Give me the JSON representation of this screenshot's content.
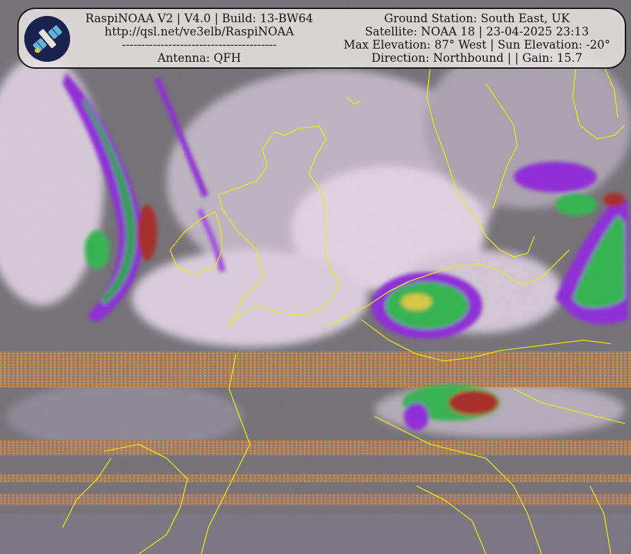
{
  "header": {
    "left": {
      "title": "RaspiNOAA V2 | V4.0 | Build: 13-BW64",
      "url": "http://qsl.net/ve3elb/RaspiNOAA",
      "divider": "----------------------------------------",
      "antenna": "Antenna: QFH"
    },
    "right": {
      "station": "Ground Station: South East, UK",
      "satellite": "Satellite: NOAA 18 | 23-04-2025 23:13",
      "elevation": "Max Elevation: 87° West | Sun Elevation: -20°",
      "direction": "Direction: Northbound | | Gain: 15.7"
    }
  },
  "logo": {
    "icon": "satellite-icon"
  },
  "colors": {
    "cloud_light": "#e4d6e4",
    "cloud_gray": "#8e8a90",
    "land_gray": "#5e5a60",
    "coastline": "#f0f000",
    "noise_orange": "#c8843e",
    "storm_purple": "#8a22d8",
    "storm_green": "#2cb24a",
    "storm_red": "#a4221c",
    "panel_bg": "#e4e0de"
  }
}
